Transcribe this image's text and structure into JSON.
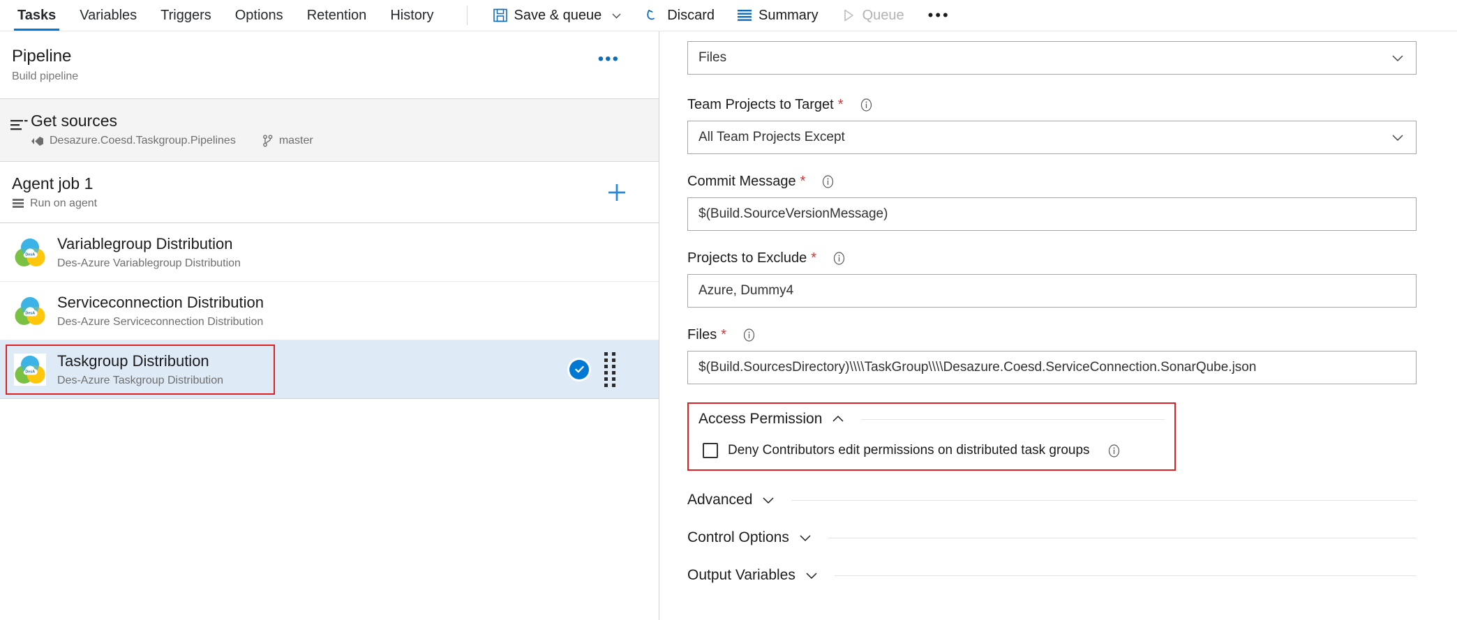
{
  "topbar": {
    "tabs": [
      {
        "label": "Tasks",
        "active": true
      },
      {
        "label": "Variables",
        "active": false
      },
      {
        "label": "Triggers",
        "active": false
      },
      {
        "label": "Options",
        "active": false
      },
      {
        "label": "Retention",
        "active": false
      },
      {
        "label": "History",
        "active": false
      }
    ],
    "actions": [
      {
        "label": "Save & queue",
        "icon": "save-icon",
        "has_chevron": true,
        "disabled": false
      },
      {
        "label": "Discard",
        "icon": "undo-icon",
        "has_chevron": false,
        "disabled": false
      },
      {
        "label": "Summary",
        "icon": "list-icon",
        "has_chevron": false,
        "disabled": false
      },
      {
        "label": "Queue",
        "icon": "play-icon",
        "has_chevron": false,
        "disabled": true
      }
    ],
    "overflow_label": "•••"
  },
  "left_panel": {
    "pipeline": {
      "title": "Pipeline",
      "subtitle": "Build pipeline",
      "menu_label": "•••"
    },
    "get_sources": {
      "title": "Get sources",
      "repository": "Desazure.Coesd.Taskgroup.Pipelines",
      "branch": "master"
    },
    "agent_job": {
      "title": "Agent job 1",
      "subtitle": "Run on agent",
      "add_label": "+"
    },
    "tasks": [
      {
        "name": "Variablegroup Distribution",
        "description": "Des-Azure Variablegroup Distribution",
        "selected": false
      },
      {
        "name": "Serviceconnection Distribution",
        "description": "Des-Azure Serviceconnection Distribution",
        "selected": false
      },
      {
        "name": "Taskgroup Distribution",
        "description": "Des-Azure Taskgroup Distribution",
        "selected": true
      }
    ]
  },
  "right_panel": {
    "top_select": {
      "value": "Files"
    },
    "fields": [
      {
        "label": "Team Projects to Target",
        "required": true,
        "type": "select",
        "value": "All Team Projects Except"
      },
      {
        "label": "Commit Message",
        "required": true,
        "type": "text",
        "value": "$(Build.SourceVersionMessage)"
      },
      {
        "label": "Projects to Exclude",
        "required": true,
        "type": "text",
        "value": "Azure, Dummy4"
      },
      {
        "label": "Files",
        "required": true,
        "type": "text",
        "value": "$(Build.SourcesDirectory)\\\\\\\\TaskGroup\\\\\\\\Desazure.Coesd.ServiceConnection.SonarQube.json"
      }
    ],
    "access_permission": {
      "title": "Access Permission",
      "expanded": true,
      "checkbox": {
        "label": "Deny Contributors edit permissions on distributed task groups",
        "checked": false
      }
    },
    "sections": [
      {
        "title": "Advanced",
        "expanded": false
      },
      {
        "title": "Control Options",
        "expanded": false
      },
      {
        "title": "Output Variables",
        "expanded": false
      }
    ]
  },
  "colors": {
    "accent": "#0078d4",
    "required_star": "#d13438",
    "annotation": "#e02020",
    "selected_row": "#deeaf6"
  }
}
